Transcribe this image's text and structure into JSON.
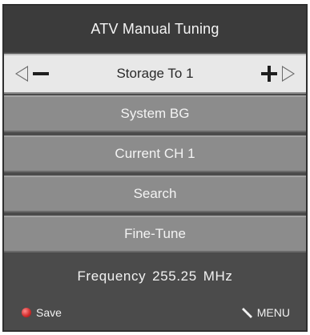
{
  "title": "ATV Manual Tuning",
  "storage": {
    "label": "Storage To 1"
  },
  "items": [
    {
      "label": "System BG"
    },
    {
      "label": "Current CH 1"
    },
    {
      "label": "Search"
    },
    {
      "label": "Fine-Tune"
    }
  ],
  "frequency": {
    "label": "Frequency",
    "value": "255.25",
    "unit": "MHz"
  },
  "footer": {
    "save_label": "Save",
    "menu_label": "MENU"
  },
  "colors": {
    "title_bg": "#3b3b3b",
    "storage_bg": "#e8e8e8",
    "item_bg": "#8c8c8c",
    "panel_bg": "#4b4b4b",
    "save_dot": "#d32f2f"
  },
  "icons": {
    "left": "arrow-left-icon",
    "right": "arrow-right-icon",
    "minus": "minus-icon",
    "plus": "plus-icon",
    "save": "red-dot-icon",
    "menu": "menu-remote-icon"
  }
}
